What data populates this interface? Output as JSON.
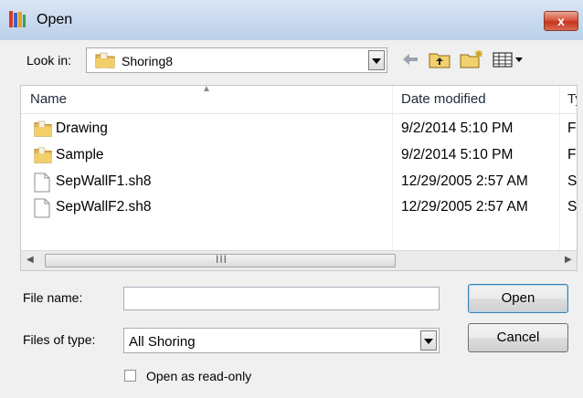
{
  "window": {
    "title": "Open"
  },
  "look_in": {
    "label": "Look in:",
    "value": "Shoring8"
  },
  "columns": {
    "name": "Name",
    "date": "Date modified",
    "type": "Ty"
  },
  "files": [
    {
      "name": "Drawing",
      "date": "9/2/2014 5:10 PM",
      "type": "Fi",
      "kind": "folder"
    },
    {
      "name": "Sample",
      "date": "9/2/2014 5:10 PM",
      "type": "Fi",
      "kind": "folder"
    },
    {
      "name": "SepWallF1.sh8",
      "date": "12/29/2005 2:57 AM",
      "type": "SH",
      "kind": "file"
    },
    {
      "name": "SepWallF2.sh8",
      "date": "12/29/2005 2:57 AM",
      "type": "SH",
      "kind": "file"
    }
  ],
  "scrollbar": {
    "grip": "III"
  },
  "file_name": {
    "label": "File name:",
    "value": ""
  },
  "file_type": {
    "label": "Files of type:",
    "value": "All Shoring"
  },
  "buttons": {
    "open": "Open",
    "cancel": "Cancel",
    "close": "x"
  },
  "read_only": {
    "label": "Open as read-only",
    "checked": false
  },
  "icons": {
    "app": "app-books-icon",
    "folder": "folder-icon",
    "file": "document-icon",
    "back": "back-arrow-icon",
    "up": "up-folder-icon",
    "new_folder": "new-folder-icon",
    "view": "view-menu-icon"
  }
}
